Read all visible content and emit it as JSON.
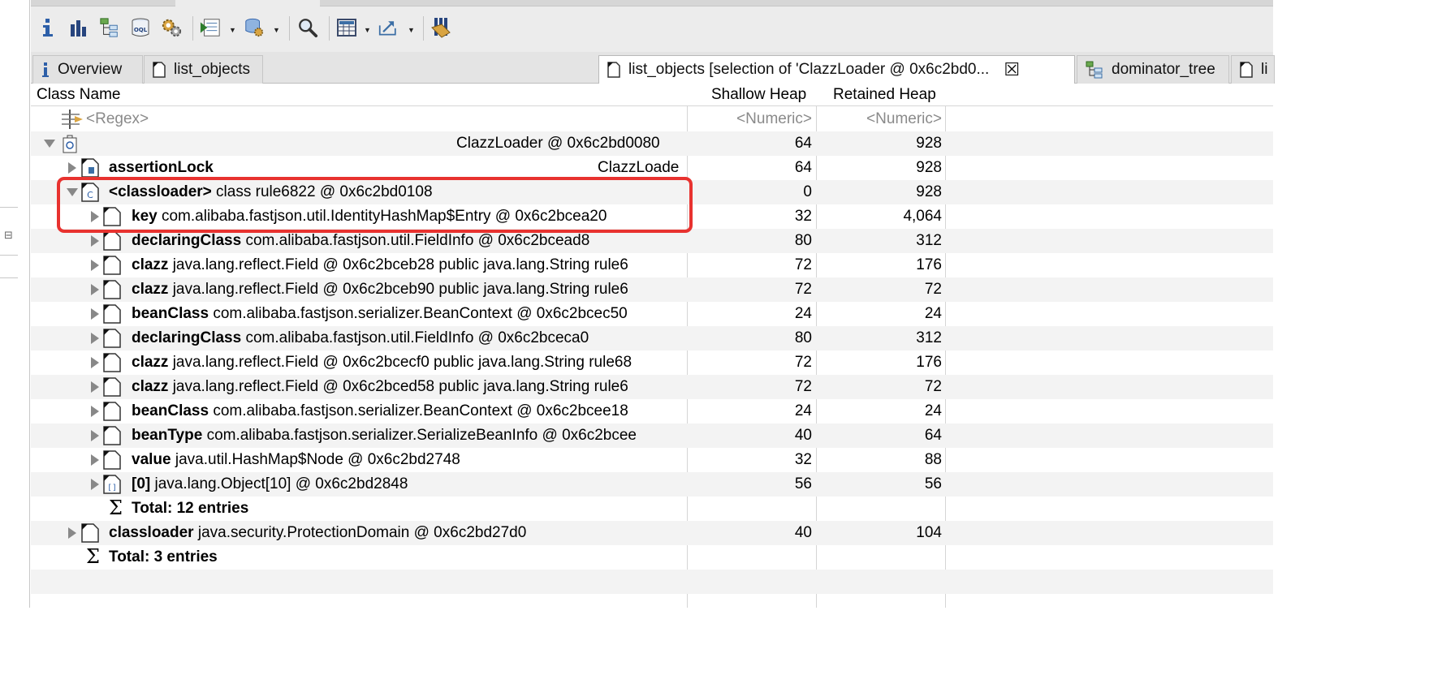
{
  "toolbar": {
    "icons": [
      "info-icon",
      "histogram-icon",
      "dominator-tree-icon",
      "oql-icon",
      "heap-dump-overview-icon",
      "run-expert-report-icon",
      "query-browser-icon",
      "search-icon",
      "calculator-icon",
      "export-icon",
      "pin-icon"
    ]
  },
  "tabs": [
    {
      "label": "Overview",
      "icon": "info-icon",
      "active": false
    },
    {
      "label": "list_objects",
      "icon": "object-list-icon",
      "active": false
    },
    {
      "label": "list_objects [selection of 'ClazzLoader @ 0x6c2bd0...",
      "icon": "object-list-icon",
      "active": true
    },
    {
      "label": "dominator_tree",
      "icon": "dominator-tree-icon",
      "active": false
    },
    {
      "label": "li",
      "icon": "object-list-icon",
      "active": false
    }
  ],
  "table": {
    "columns": [
      "Class Name",
      "Shallow Heap",
      "Retained Heap"
    ],
    "filter": {
      "name": "<Regex>",
      "shallow": "<Numeric>",
      "retained": "<Numeric>"
    },
    "rows": [
      {
        "field": "",
        "value": "ClazzLoader @ 0x6c2bd0080",
        "shallow": "64",
        "retained": "928"
      },
      {
        "field": "assertionLock",
        "value": "ClazzLoade",
        "shallow": "64",
        "retained": "928"
      },
      {
        "field": "<classloader>",
        "value": "class rule6822 @ 0x6c2bd0108",
        "shallow": "0",
        "retained": "928"
      },
      {
        "field": "key",
        "value": "com.alibaba.fastjson.util.IdentityHashMap$Entry @ 0x6c2bcea20",
        "shallow": "32",
        "retained": "4,064"
      },
      {
        "field": "declaringClass",
        "value": "com.alibaba.fastjson.util.FieldInfo @ 0x6c2bcead8",
        "shallow": "80",
        "retained": "312"
      },
      {
        "field": "clazz",
        "value": "java.lang.reflect.Field @ 0x6c2bceb28  public java.lang.String rule6",
        "shallow": "72",
        "retained": "176"
      },
      {
        "field": "clazz",
        "value": "java.lang.reflect.Field @ 0x6c2bceb90  public java.lang.String rule6",
        "shallow": "72",
        "retained": "72"
      },
      {
        "field": "beanClass",
        "value": "com.alibaba.fastjson.serializer.BeanContext @ 0x6c2bcec50",
        "shallow": "24",
        "retained": "24"
      },
      {
        "field": "declaringClass",
        "value": "com.alibaba.fastjson.util.FieldInfo @ 0x6c2bceca0",
        "shallow": "80",
        "retained": "312"
      },
      {
        "field": "clazz",
        "value": "java.lang.reflect.Field @ 0x6c2bcecf0  public java.lang.String rule68",
        "shallow": "72",
        "retained": "176"
      },
      {
        "field": "clazz",
        "value": "java.lang.reflect.Field @ 0x6c2bced58  public java.lang.String rule6",
        "shallow": "72",
        "retained": "72"
      },
      {
        "field": "beanClass",
        "value": "com.alibaba.fastjson.serializer.BeanContext @ 0x6c2bcee18",
        "shallow": "24",
        "retained": "24"
      },
      {
        "field": "beanType",
        "value": "com.alibaba.fastjson.serializer.SerializeBeanInfo @ 0x6c2bcee",
        "shallow": "40",
        "retained": "64"
      },
      {
        "field": "value",
        "value": "java.util.HashMap$Node @ 0x6c2bd2748",
        "shallow": "32",
        "retained": "88"
      },
      {
        "field": "[0]",
        "value": "java.lang.Object[10] @ 0x6c2bd2848",
        "shallow": "56",
        "retained": "56"
      },
      {
        "total": "Total: 12 entries"
      },
      {
        "field": "classloader",
        "value": "java.security.ProtectionDomain @ 0x6c2bd27d0",
        "shallow": "40",
        "retained": "104"
      },
      {
        "total": "Total: 3 entries"
      }
    ]
  },
  "colors": {
    "highlight": "#e8322f",
    "toolbar_bg": "#ececec",
    "row_alt": "#f3f3f3"
  }
}
